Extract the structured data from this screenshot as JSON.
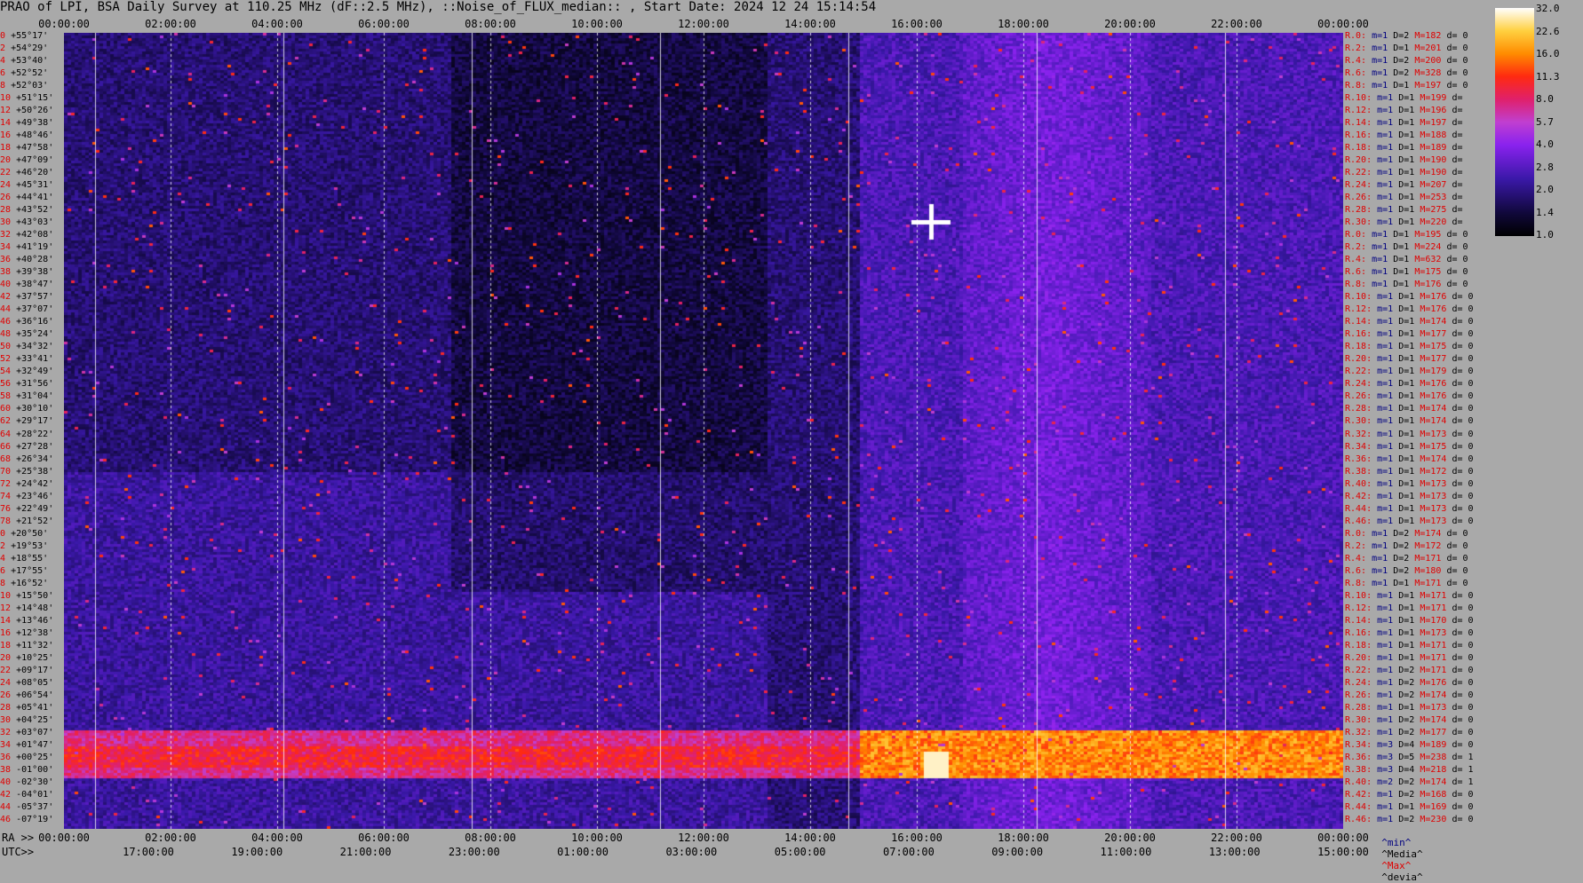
{
  "title": "PRAO of LPI, BSA Daily Survey at 110.25 MHz (dF::2.5 MHz), ::Noise_of_FLUX_median:: , Start Date: 2024 12 24 15:14:54",
  "top_axis_ticks": [
    "00:00:00",
    "02:00:00",
    "04:00:00",
    "06:00:00",
    "08:00:00",
    "10:00:00",
    "12:00:00",
    "14:00:00",
    "16:00:00",
    "18:00:00",
    "20:00:00",
    "22:00:00",
    "00:00:00"
  ],
  "bottom_axis": {
    "ra_label": "RA >>",
    "ra_ticks": [
      "00:00:00",
      "02:00:00",
      "04:00:00",
      "06:00:00",
      "08:00:00",
      "10:00:00",
      "12:00:00",
      "14:00:00",
      "16:00:00",
      "18:00:00",
      "20:00:00",
      "22:00:00",
      "00:00:00"
    ],
    "utc_label": "UTC>>",
    "utc_ticks": [
      "17:00:00",
      "19:00:00",
      "21:00:00",
      "23:00:00",
      "01:00:00",
      "03:00:00",
      "05:00:00",
      "07:00:00",
      "09:00:00",
      "11:00:00",
      "13:00:00",
      "15:00:00"
    ]
  },
  "colorbar": {
    "ticks": [
      "32.0",
      "22.6",
      "16.0",
      "11.3",
      "8.0",
      "5.7",
      "4.0",
      "2.8",
      "2.0",
      "1.4",
      "1.0"
    ]
  },
  "legend": {
    "min": "^min^",
    "median": "^Media^",
    "max": "^Max^",
    "devia": "^devia^"
  },
  "colors": {
    "background": "#a9a9a9",
    "red_text": "#e00000",
    "blue_text": "#000080"
  },
  "chart_data": {
    "type": "heatmap",
    "title": "PRAO of LPI, BSA Daily Survey at 110.25 MHz (dF::2.5 MHz), ::Noise_of_FLUX_median:: , Start Date: 2024 12 24 15:14:54",
    "x_axis": "RA / UTC",
    "colorbar_range": [
      1.0,
      32.0
    ],
    "colorbar_scale": "log",
    "rows": [
      {
        "i": "0",
        "dec": "+55°17'",
        "r": "R.0:",
        "m": "m=1",
        "d": "D=2",
        "M": "M=182",
        "dv": "d= 0"
      },
      {
        "i": "2",
        "dec": "+54°29'",
        "r": "R.2:",
        "m": "m=1",
        "d": "D=1",
        "M": "M=201",
        "dv": "d= 0"
      },
      {
        "i": "4",
        "dec": "+53°40'",
        "r": "R.4:",
        "m": "m=1",
        "d": "D=2",
        "M": "M=200",
        "dv": "d= 0"
      },
      {
        "i": "6",
        "dec": "+52°52'",
        "r": "R.6:",
        "m": "m=1",
        "d": "D=2",
        "M": "M=328",
        "dv": "d= 0"
      },
      {
        "i": "8",
        "dec": "+52°03'",
        "r": "R.8:",
        "m": "m=1",
        "d": "D=1",
        "M": "M=197",
        "dv": "d= 0"
      },
      {
        "i": "10",
        "dec": "+51°15'",
        "r": "R.10:",
        "m": "m=1",
        "d": "D=1",
        "M": "M=199",
        "dv": "d="
      },
      {
        "i": "12",
        "dec": "+50°26'",
        "r": "R.12:",
        "m": "m=1",
        "d": "D=1",
        "M": "M=196",
        "dv": "d="
      },
      {
        "i": "14",
        "dec": "+49°38'",
        "r": "R.14:",
        "m": "m=1",
        "d": "D=1",
        "M": "M=197",
        "dv": "d="
      },
      {
        "i": "16",
        "dec": "+48°46'",
        "r": "R.16:",
        "m": "m=1",
        "d": "D=1",
        "M": "M=188",
        "dv": "d="
      },
      {
        "i": "18",
        "dec": "+47°58'",
        "r": "R.18:",
        "m": "m=1",
        "d": "D=1",
        "M": "M=189",
        "dv": "d="
      },
      {
        "i": "20",
        "dec": "+47°09'",
        "r": "R.20:",
        "m": "m=1",
        "d": "D=1",
        "M": "M=190",
        "dv": "d="
      },
      {
        "i": "22",
        "dec": "+46°20'",
        "r": "R.22:",
        "m": "m=1",
        "d": "D=1",
        "M": "M=190",
        "dv": "d="
      },
      {
        "i": "24",
        "dec": "+45°31'",
        "r": "R.24:",
        "m": "m=1",
        "d": "D=1",
        "M": "M=207",
        "dv": "d="
      },
      {
        "i": "26",
        "dec": "+44°41'",
        "r": "R.26:",
        "m": "m=1",
        "d": "D=1",
        "M": "M=253",
        "dv": "d="
      },
      {
        "i": "28",
        "dec": "+43°52'",
        "r": "R.28:",
        "m": "m=1",
        "d": "D=1",
        "M": "M=275",
        "dv": "d="
      },
      {
        "i": "30",
        "dec": "+43°03'",
        "r": "R.30:",
        "m": "m=1",
        "d": "D=1",
        "M": "M=220",
        "dv": "d="
      },
      {
        "i": "32",
        "dec": "+42°08'",
        "r": "R.0:",
        "m": "m=1",
        "d": "D=1",
        "M": "M=195",
        "dv": "d= 0"
      },
      {
        "i": "34",
        "dec": "+41°19'",
        "r": "R.2:",
        "m": "m=1",
        "d": "D=1",
        "M": "M=224",
        "dv": "d= 0"
      },
      {
        "i": "36",
        "dec": "+40°28'",
        "r": "R.4:",
        "m": "m=1",
        "d": "D=1",
        "M": "M=632",
        "dv": "d= 0"
      },
      {
        "i": "38",
        "dec": "+39°38'",
        "r": "R.6:",
        "m": "m=1",
        "d": "D=1",
        "M": "M=175",
        "dv": "d= 0"
      },
      {
        "i": "40",
        "dec": "+38°47'",
        "r": "R.8:",
        "m": "m=1",
        "d": "D=1",
        "M": "M=176",
        "dv": "d= 0"
      },
      {
        "i": "42",
        "dec": "+37°57'",
        "r": "R.10:",
        "m": "m=1",
        "d": "D=1",
        "M": "M=176",
        "dv": "d= 0"
      },
      {
        "i": "44",
        "dec": "+37°07'",
        "r": "R.12:",
        "m": "m=1",
        "d": "D=1",
        "M": "M=176",
        "dv": "d= 0"
      },
      {
        "i": "46",
        "dec": "+36°16'",
        "r": "R.14:",
        "m": "m=1",
        "d": "D=1",
        "M": "M=174",
        "dv": "d= 0"
      },
      {
        "i": "48",
        "dec": "+35°24'",
        "r": "R.16:",
        "m": "m=1",
        "d": "D=1",
        "M": "M=177",
        "dv": "d= 0"
      },
      {
        "i": "50",
        "dec": "+34°32'",
        "r": "R.18:",
        "m": "m=1",
        "d": "D=1",
        "M": "M=175",
        "dv": "d= 0"
      },
      {
        "i": "52",
        "dec": "+33°41'",
        "r": "R.20:",
        "m": "m=1",
        "d": "D=1",
        "M": "M=177",
        "dv": "d= 0"
      },
      {
        "i": "54",
        "dec": "+32°49'",
        "r": "R.22:",
        "m": "m=1",
        "d": "D=1",
        "M": "M=179",
        "dv": "d= 0"
      },
      {
        "i": "56",
        "dec": "+31°56'",
        "r": "R.24:",
        "m": "m=1",
        "d": "D=1",
        "M": "M=176",
        "dv": "d= 0"
      },
      {
        "i": "58",
        "dec": "+31°04'",
        "r": "R.26:",
        "m": "m=1",
        "d": "D=1",
        "M": "M=176",
        "dv": "d= 0"
      },
      {
        "i": "60",
        "dec": "+30°10'",
        "r": "R.28:",
        "m": "m=1",
        "d": "D=1",
        "M": "M=174",
        "dv": "d= 0"
      },
      {
        "i": "62",
        "dec": "+29°17'",
        "r": "R.30:",
        "m": "m=1",
        "d": "D=1",
        "M": "M=174",
        "dv": "d= 0"
      },
      {
        "i": "64",
        "dec": "+28°22'",
        "r": "R.32:",
        "m": "m=1",
        "d": "D=1",
        "M": "M=173",
        "dv": "d= 0"
      },
      {
        "i": "66",
        "dec": "+27°28'",
        "r": "R.34:",
        "m": "m=1",
        "d": "D=1",
        "M": "M=175",
        "dv": "d= 0"
      },
      {
        "i": "68",
        "dec": "+26°34'",
        "r": "R.36:",
        "m": "m=1",
        "d": "D=1",
        "M": "M=174",
        "dv": "d= 0"
      },
      {
        "i": "70",
        "dec": "+25°38'",
        "r": "R.38:",
        "m": "m=1",
        "d": "D=1",
        "M": "M=172",
        "dv": "d= 0"
      },
      {
        "i": "72",
        "dec": "+24°42'",
        "r": "R.40:",
        "m": "m=1",
        "d": "D=1",
        "M": "M=173",
        "dv": "d= 0"
      },
      {
        "i": "74",
        "dec": "+23°46'",
        "r": "R.42:",
        "m": "m=1",
        "d": "D=1",
        "M": "M=173",
        "dv": "d= 0"
      },
      {
        "i": "76",
        "dec": "+22°49'",
        "r": "R.44:",
        "m": "m=1",
        "d": "D=1",
        "M": "M=173",
        "dv": "d= 0"
      },
      {
        "i": "78",
        "dec": "+21°52'",
        "r": "R.46:",
        "m": "m=1",
        "d": "D=1",
        "M": "M=173",
        "dv": "d= 0"
      },
      {
        "i": "0",
        "dec": "+20°50'",
        "r": "R.0:",
        "m": "m=1",
        "d": "D=2",
        "M": "M=174",
        "dv": "d= 0"
      },
      {
        "i": "2",
        "dec": "+19°53'",
        "r": "R.2:",
        "m": "m=1",
        "d": "D=2",
        "M": "M=172",
        "dv": "d= 0"
      },
      {
        "i": "4",
        "dec": "+18°55'",
        "r": "R.4:",
        "m": "m=1",
        "d": "D=2",
        "M": "M=171",
        "dv": "d= 0"
      },
      {
        "i": "6",
        "dec": "+17°55'",
        "r": "R.6:",
        "m": "m=1",
        "d": "D=2",
        "M": "M=180",
        "dv": "d= 0"
      },
      {
        "i": "8",
        "dec": "+16°52'",
        "r": "R.8:",
        "m": "m=1",
        "d": "D=1",
        "M": "M=171",
        "dv": "d= 0"
      },
      {
        "i": "10",
        "dec": "+15°50'",
        "r": "R.10:",
        "m": "m=1",
        "d": "D=1",
        "M": "M=171",
        "dv": "d= 0"
      },
      {
        "i": "12",
        "dec": "+14°48'",
        "r": "R.12:",
        "m": "m=1",
        "d": "D=1",
        "M": "M=171",
        "dv": "d= 0"
      },
      {
        "i": "14",
        "dec": "+13°46'",
        "r": "R.14:",
        "m": "m=1",
        "d": "D=1",
        "M": "M=170",
        "dv": "d= 0"
      },
      {
        "i": "16",
        "dec": "+12°38'",
        "r": "R.16:",
        "m": "m=1",
        "d": "D=1",
        "M": "M=173",
        "dv": "d= 0"
      },
      {
        "i": "18",
        "dec": "+11°32'",
        "r": "R.18:",
        "m": "m=1",
        "d": "D=1",
        "M": "M=171",
        "dv": "d= 0"
      },
      {
        "i": "20",
        "dec": "+10°25'",
        "r": "R.20:",
        "m": "m=1",
        "d": "D=1",
        "M": "M=171",
        "dv": "d= 0"
      },
      {
        "i": "22",
        "dec": "+09°17'",
        "r": "R.22:",
        "m": "m=1",
        "d": "D=2",
        "M": "M=171",
        "dv": "d= 0"
      },
      {
        "i": "24",
        "dec": "+08°05'",
        "r": "R.24:",
        "m": "m=1",
        "d": "D=2",
        "M": "M=176",
        "dv": "d= 0"
      },
      {
        "i": "26",
        "dec": "+06°54'",
        "r": "R.26:",
        "m": "m=1",
        "d": "D=2",
        "M": "M=174",
        "dv": "d= 0"
      },
      {
        "i": "28",
        "dec": "+05°41'",
        "r": "R.28:",
        "m": "m=1",
        "d": "D=1",
        "M": "M=173",
        "dv": "d= 0"
      },
      {
        "i": "30",
        "dec": "+04°25'",
        "r": "R.30:",
        "m": "m=1",
        "d": "D=2",
        "M": "M=174",
        "dv": "d= 0"
      },
      {
        "i": "32",
        "dec": "+03°07'",
        "r": "R.32:",
        "m": "m=1",
        "d": "D=2",
        "M": "M=177",
        "dv": "d= 0"
      },
      {
        "i": "34",
        "dec": "+01°47'",
        "r": "R.34:",
        "m": "m=3",
        "d": "D=4",
        "M": "M=189",
        "dv": "d= 0"
      },
      {
        "i": "36",
        "dec": "+00°25'",
        "r": "R.36:",
        "m": "m=3",
        "d": "D=5",
        "M": "M=238",
        "dv": "d= 1"
      },
      {
        "i": "38",
        "dec": "-01°00'",
        "r": "R.38:",
        "m": "m=3",
        "d": "D=4",
        "M": "M=218",
        "dv": "d= 1"
      },
      {
        "i": "40",
        "dec": "-02°30'",
        "r": "R.40:",
        "m": "m=2",
        "d": "D=2",
        "M": "M=174",
        "dv": "d= 1"
      },
      {
        "i": "42",
        "dec": "-04°01'",
        "r": "R.42:",
        "m": "m=1",
        "d": "D=2",
        "M": "M=168",
        "dv": "d= 0"
      },
      {
        "i": "44",
        "dec": "-05°37'",
        "r": "R.44:",
        "m": "m=1",
        "d": "D=1",
        "M": "M=169",
        "dv": "d= 0"
      },
      {
        "i": "46",
        "dec": "-07°19'",
        "r": "R.46:",
        "m": "m=1",
        "d": "D=2",
        "M": "M=230",
        "dv": "d= 0"
      }
    ]
  }
}
